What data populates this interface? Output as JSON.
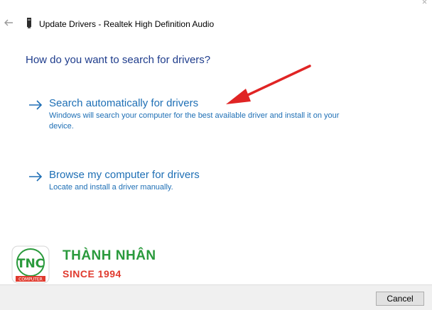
{
  "window": {
    "title": "Update Drivers - Realtek High Definition Audio"
  },
  "heading": "How do you want to search for drivers?",
  "options": [
    {
      "title": "Search automatically for drivers",
      "description": "Windows will search your computer for the best available driver and install it on your device."
    },
    {
      "title": "Browse my computer for drivers",
      "description": "Locate and install a driver manually."
    }
  ],
  "watermark": {
    "badge_letters": "TNC",
    "badge_caption": "COMPUTER",
    "brand_name": "THÀNH NHÂN",
    "since": "SINCE 1994"
  },
  "footer": {
    "cancel_label": "Cancel"
  },
  "colors": {
    "heading": "#1e3c8c",
    "link": "#1e6fb5",
    "annotation_arrow": "#e02424",
    "brand_green": "#2a9a3c",
    "brand_red": "#e03a2e"
  },
  "icons": {
    "back": "back-arrow-icon",
    "device": "device-icon",
    "option_arrow": "right-arrow-icon"
  }
}
